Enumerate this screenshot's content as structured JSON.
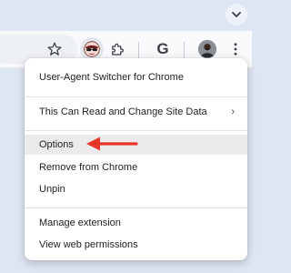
{
  "toolbar": {
    "icons": [
      "star-icon",
      "user-agent-switcher-extension-icon",
      "puzzle-icon",
      "google-extension-icon",
      "profile-avatar",
      "kebab-menu-icon"
    ],
    "google_letter": "G",
    "kebab": "⋮"
  },
  "menu": {
    "header": "User-Agent Switcher for Chrome",
    "site_access": "This Can Read and Change Site Data",
    "chevron": "›",
    "options": "Options",
    "remove": "Remove from Chrome",
    "unpin": "Unpin",
    "manage": "Manage extension",
    "permissions": "View web permissions"
  },
  "colors": {
    "annotation_arrow": "#e8352a",
    "hover_row": "#ebebeb"
  }
}
